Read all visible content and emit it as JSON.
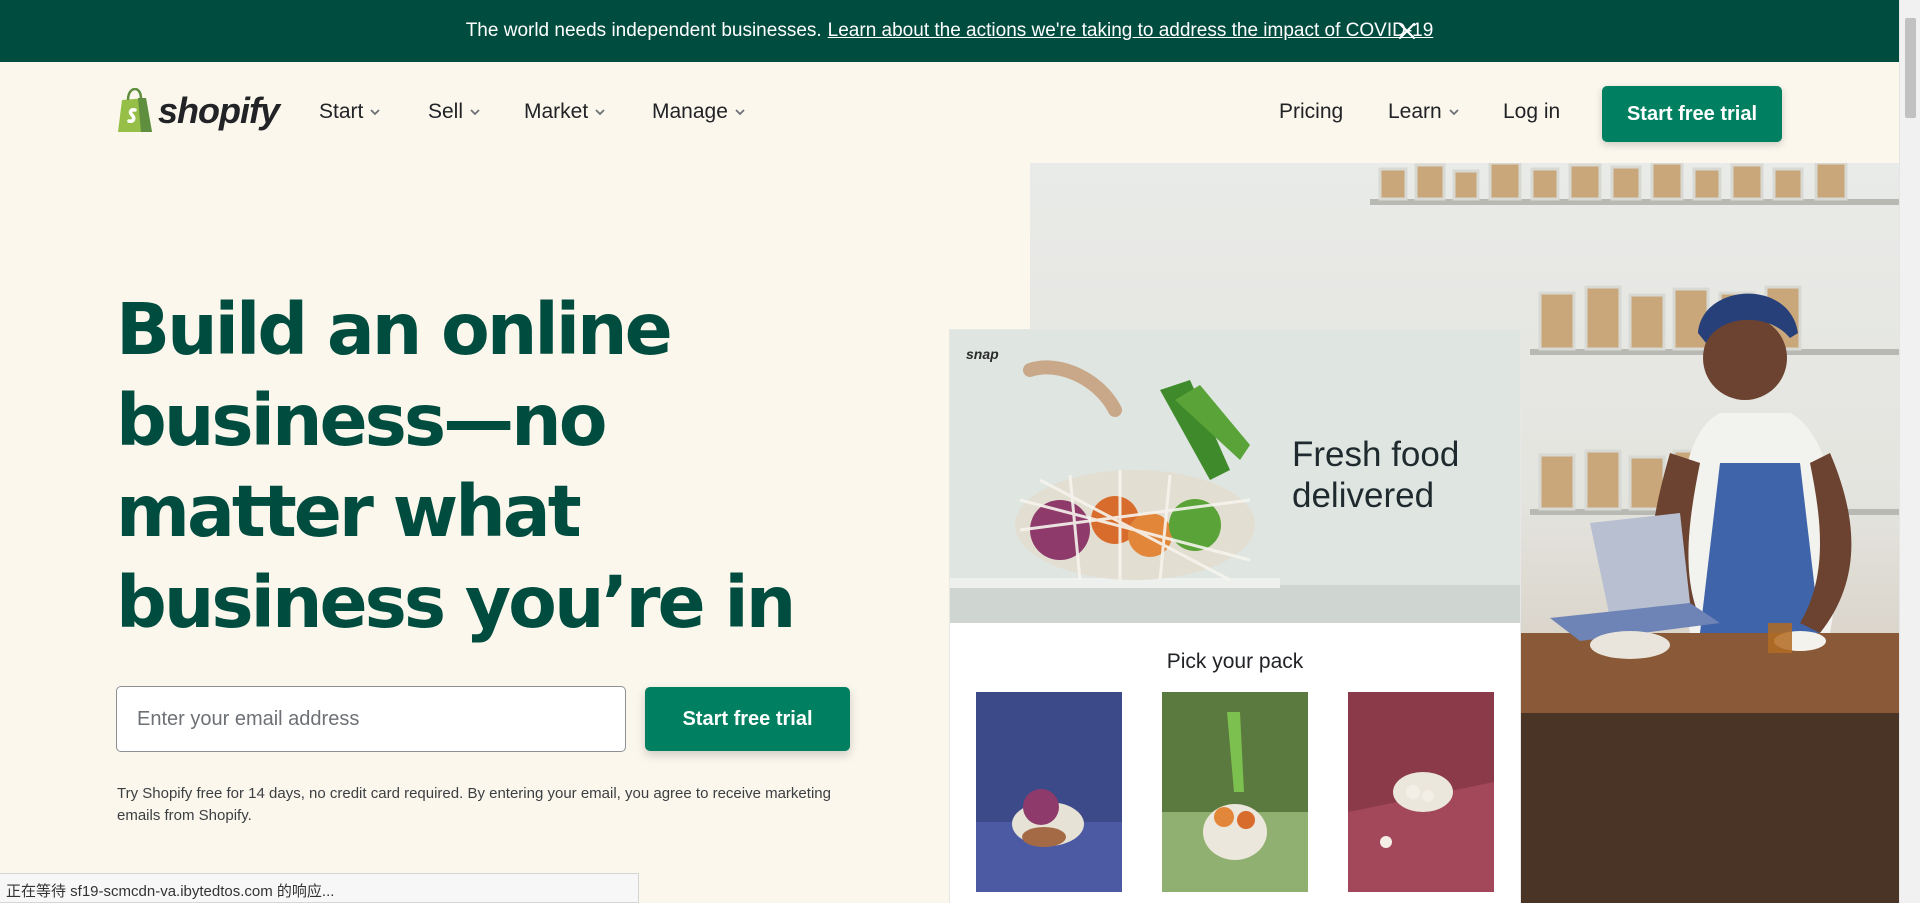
{
  "announcement": {
    "message": "The world needs independent businesses.",
    "link_text": "Learn about the actions we're taking to address the impact of COVID-19"
  },
  "header": {
    "logo_text": "shopify",
    "nav": [
      {
        "label": "Start"
      },
      {
        "label": "Sell"
      },
      {
        "label": "Market"
      },
      {
        "label": "Manage"
      }
    ],
    "pricing": "Pricing",
    "learn": "Learn",
    "login": "Log in",
    "cta": "Start free trial"
  },
  "hero": {
    "headline": "Build an online business—no matter what business you’re in",
    "email_placeholder": "Enter your email address",
    "cta": "Start free trial",
    "disclaimer": "Try Shopify free for 14 days, no credit card required. By entering your email, you agree to receive marketing emails from Shopify."
  },
  "showcase": {
    "brand": "snap",
    "headline": "Fresh food delivered",
    "section_title": "Pick your pack"
  },
  "status_bar": "正在等待 sf19-scmcdn-va.ibytedtos.com 的响应...",
  "colors": {
    "brand_dark": "#004c3f",
    "brand_green": "#008060",
    "background": "#fbf7ed"
  }
}
